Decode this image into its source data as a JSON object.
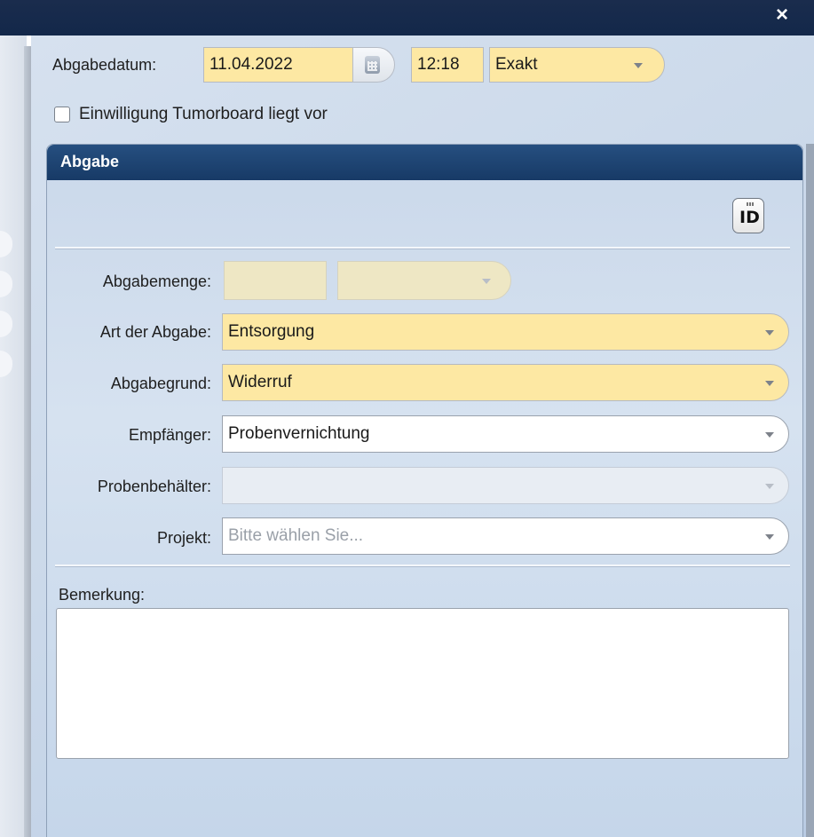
{
  "window": {
    "close_glyph": "×"
  },
  "form": {
    "abgabedatum_label": "Abgabedatum:",
    "date_value": "11.04.2022",
    "time_value": "12:18",
    "precision_value": "Exakt",
    "consent_label": "Einwilligung Tumorboard liegt vor",
    "consent_checked": false
  },
  "panel": {
    "title": "Abgabe",
    "id_button_label": "ID",
    "fields": {
      "abgabemenge_label": "Abgabemenge:",
      "art_label": "Art der Abgabe:",
      "art_value": "Entsorgung",
      "grund_label": "Abgabegrund:",
      "grund_value": "Widerruf",
      "empfaenger_label": "Empfänger:",
      "empfaenger_value": "Probenvernichtung",
      "behaelter_label": "Probenbehälter:",
      "behaelter_value": "",
      "projekt_label": "Projekt:",
      "projekt_placeholder": "Bitte wählen Sie...",
      "bemerkung_label": "Bemerkung:",
      "bemerkung_value": ""
    }
  },
  "colors": {
    "titlebar": "#13284a",
    "panel_header": "#1f4677",
    "required_field": "#fde8a3",
    "background": "#cbd9ea"
  },
  "icons": [
    "close-icon",
    "calendar-icon",
    "chevron-down-icon",
    "id-scan-icon",
    "checkbox"
  ]
}
